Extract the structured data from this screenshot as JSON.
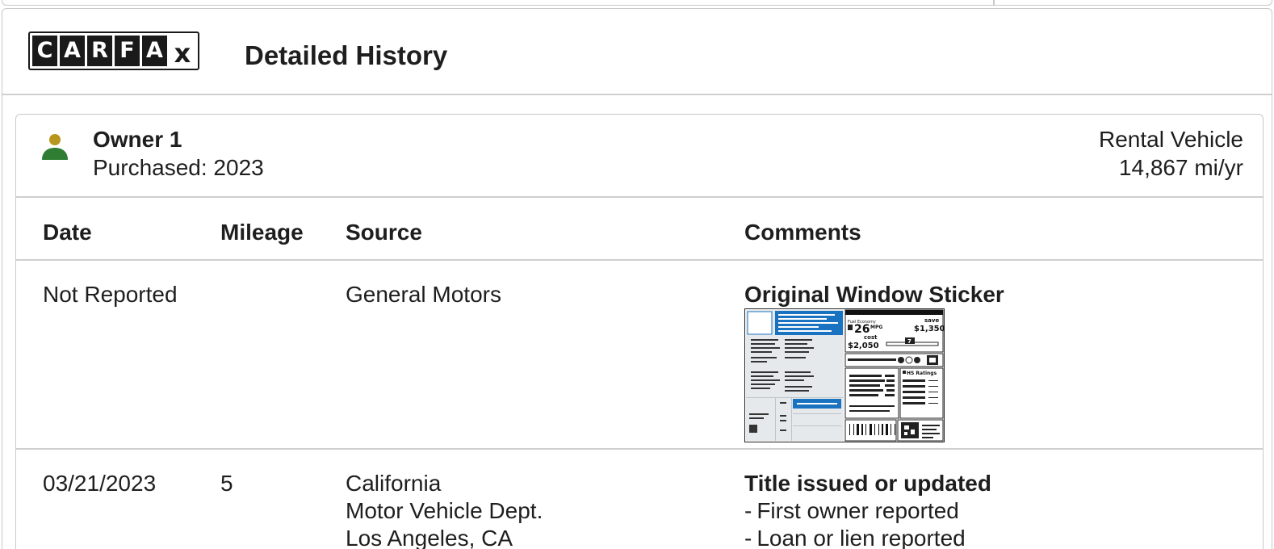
{
  "header": {
    "logo_letters": [
      "C",
      "A",
      "R",
      "F",
      "A"
    ],
    "logo_tail": "x",
    "title": "Detailed History"
  },
  "owner": {
    "name": "Owner 1",
    "purchased": "Purchased: 2023",
    "type": "Rental Vehicle",
    "miles_per_year": "14,867 mi/yr",
    "icon_colors": {
      "head": "#b8961e",
      "body": "#2e7d32"
    }
  },
  "table": {
    "headers": [
      "Date",
      "Mileage",
      "Source",
      "Comments"
    ],
    "rows": [
      {
        "date": "Not Reported",
        "mileage": "",
        "source": [
          "General Motors"
        ],
        "comment_title": "Original Window Sticker",
        "comment_lines": [],
        "sticker": {
          "mpg": "26",
          "mpg_unit": "MPG",
          "you_save_label": "save",
          "you_save": "$1,350",
          "fuel_cost_label": "cost",
          "fuel_cost": "$2,050",
          "gauge_value": "7",
          "ratings_title": "HS Ratings",
          "accent": "#1a73c0"
        }
      },
      {
        "date": "03/21/2023",
        "mileage": "5",
        "source": [
          "California",
          "Motor Vehicle Dept.",
          "Los Angeles, CA"
        ],
        "comment_title": "Title issued or updated",
        "comment_lines": [
          "First owner reported",
          "Loan or lien reported"
        ]
      }
    ]
  }
}
